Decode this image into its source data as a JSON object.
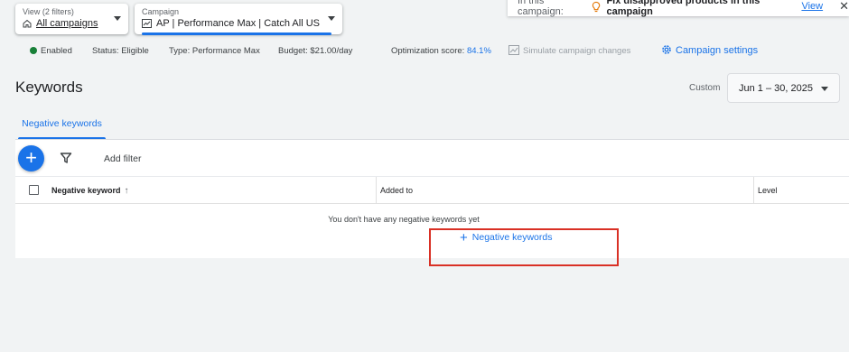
{
  "view_selector": {
    "label": "View (2 filters)",
    "value": "All campaigns"
  },
  "campaign_selector": {
    "label": "Campaign",
    "value": "AP | Performance Max | Catch All US"
  },
  "notification": {
    "label": "In this campaign:",
    "text": "Fix disapproved products in this campaign",
    "link": "View"
  },
  "status": {
    "enabled": "Enabled",
    "status": "Status: Eligible",
    "type": "Type: Performance Max",
    "budget": "Budget: $21.00/day",
    "opt_label": "Optimization score:",
    "opt_value": "84.1%",
    "simulate": "Simulate campaign changes",
    "settings": "Campaign settings"
  },
  "page": {
    "title": "Keywords"
  },
  "date_range": {
    "label": "Custom",
    "value": "Jun 1 – 30, 2025"
  },
  "tabs": [
    {
      "label": "Negative keywords"
    }
  ],
  "toolbar": {
    "add_filter": "Add filter"
  },
  "table": {
    "columns": [
      "Negative keyword",
      "Added to",
      "Level"
    ],
    "empty_message": "You don't have any negative keywords yet",
    "empty_action": "Negative keywords"
  },
  "colors": {
    "accent": "#1a73e8",
    "enabled": "#188038",
    "highlight": "#d93025"
  }
}
